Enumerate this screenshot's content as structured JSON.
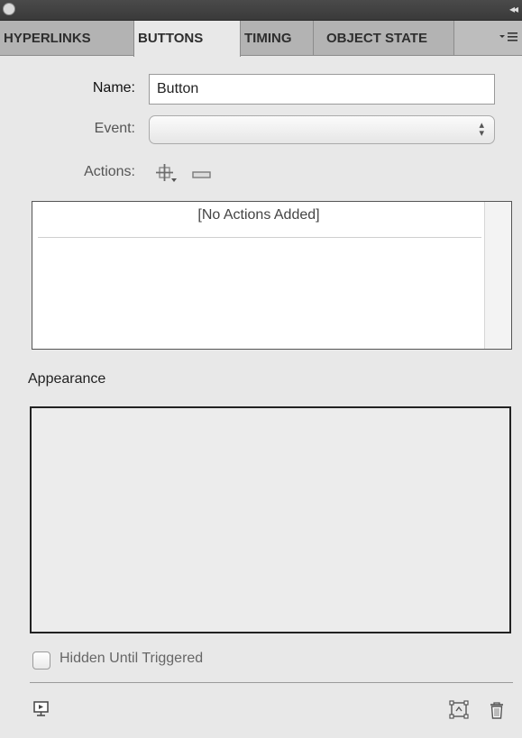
{
  "tabs": [
    {
      "label": "HYPERLINKS",
      "active": false
    },
    {
      "label": "BUTTONS",
      "active": true
    },
    {
      "label": "TIMING",
      "active": false
    },
    {
      "label": "OBJECT STATE",
      "active": false
    }
  ],
  "form": {
    "name_label": "Name:",
    "name_value": "Button",
    "event_label": "Event:",
    "event_value": "",
    "actions_label": "Actions:"
  },
  "actions_list": {
    "empty_text": "[No Actions Added]"
  },
  "appearance": {
    "title": "Appearance"
  },
  "options": {
    "hidden_until_triggered_label": "Hidden Until Triggered",
    "hidden_until_triggered_checked": false
  },
  "icons": {
    "close": "close-icon",
    "collapse": "double-chevron-left-icon",
    "panel_menu": "panel-menu-icon",
    "add_action": "add-icon",
    "remove_action": "minus-icon",
    "preview": "preview-spread-icon",
    "convert": "convert-object-icon",
    "delete": "trash-icon"
  }
}
